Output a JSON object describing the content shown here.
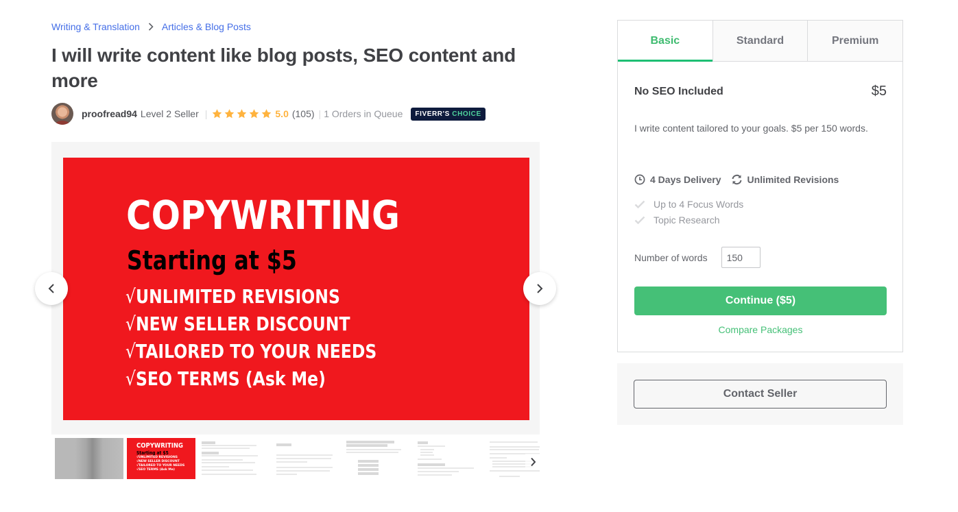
{
  "breadcrumb": {
    "items": [
      "Writing & Translation",
      "Articles & Blog Posts"
    ],
    "separator_icon": "chevron-right-icon"
  },
  "gig": {
    "title": "I will write content like blog posts, SEO content and more"
  },
  "seller": {
    "username": "proofread94",
    "level": "Level 2 Seller",
    "rating": "5.0",
    "stars": 5,
    "reviews": "(105)",
    "queue": "1 Orders in Queue",
    "badge_prefix": "FIVERR'S",
    "badge_highlight": "CHOICE"
  },
  "gallery": {
    "banner": {
      "headline": "COPYWRITING",
      "subheadline": "Starting at $5",
      "tick": "√",
      "bullets": [
        "UNLIMITED REVISIONS",
        "NEW SELLER DISCOUNT",
        "TAILORED TO YOUR NEEDS",
        "SEO TERMS (Ask Me)"
      ]
    },
    "thumbnails_count": 7,
    "thumb_banner": {
      "headline": "COPYWRITING",
      "subheadline": "Starting at $5",
      "bullets": [
        "√UNLIMITED REVISIONS",
        "√NEW SELLER DISCOUNT",
        "√TAILORED TO YOUR NEEDS",
        "√SEO TERMS (Ask Me)"
      ]
    },
    "prev_icon": "chevron-left-icon",
    "next_icon": "chevron-right-icon"
  },
  "packages": {
    "tabs": [
      {
        "label": "Basic",
        "active": true
      },
      {
        "label": "Standard",
        "active": false
      },
      {
        "label": "Premium",
        "active": false
      }
    ],
    "selected": {
      "name": "No SEO Included",
      "price": "$5",
      "description": "I write content tailored to your goals. $5 per 150 words.",
      "delivery": "4 Days Delivery",
      "revisions": "Unlimited Revisions",
      "features": [
        "Up to 4 Focus Words",
        "Topic Research"
      ],
      "words_label": "Number of words",
      "words_value": "150",
      "continue_label": "Continue ($5)",
      "compare_label": "Compare Packages"
    }
  },
  "contact": {
    "label": "Contact Seller"
  },
  "colors": {
    "brand_green": "#1dbf73",
    "button_green": "#45c077",
    "link_blue": "#446ee7",
    "star_yellow": "#ffb33e",
    "banner_red": "#f0181e",
    "badge_navy": "#0e1b3d"
  }
}
